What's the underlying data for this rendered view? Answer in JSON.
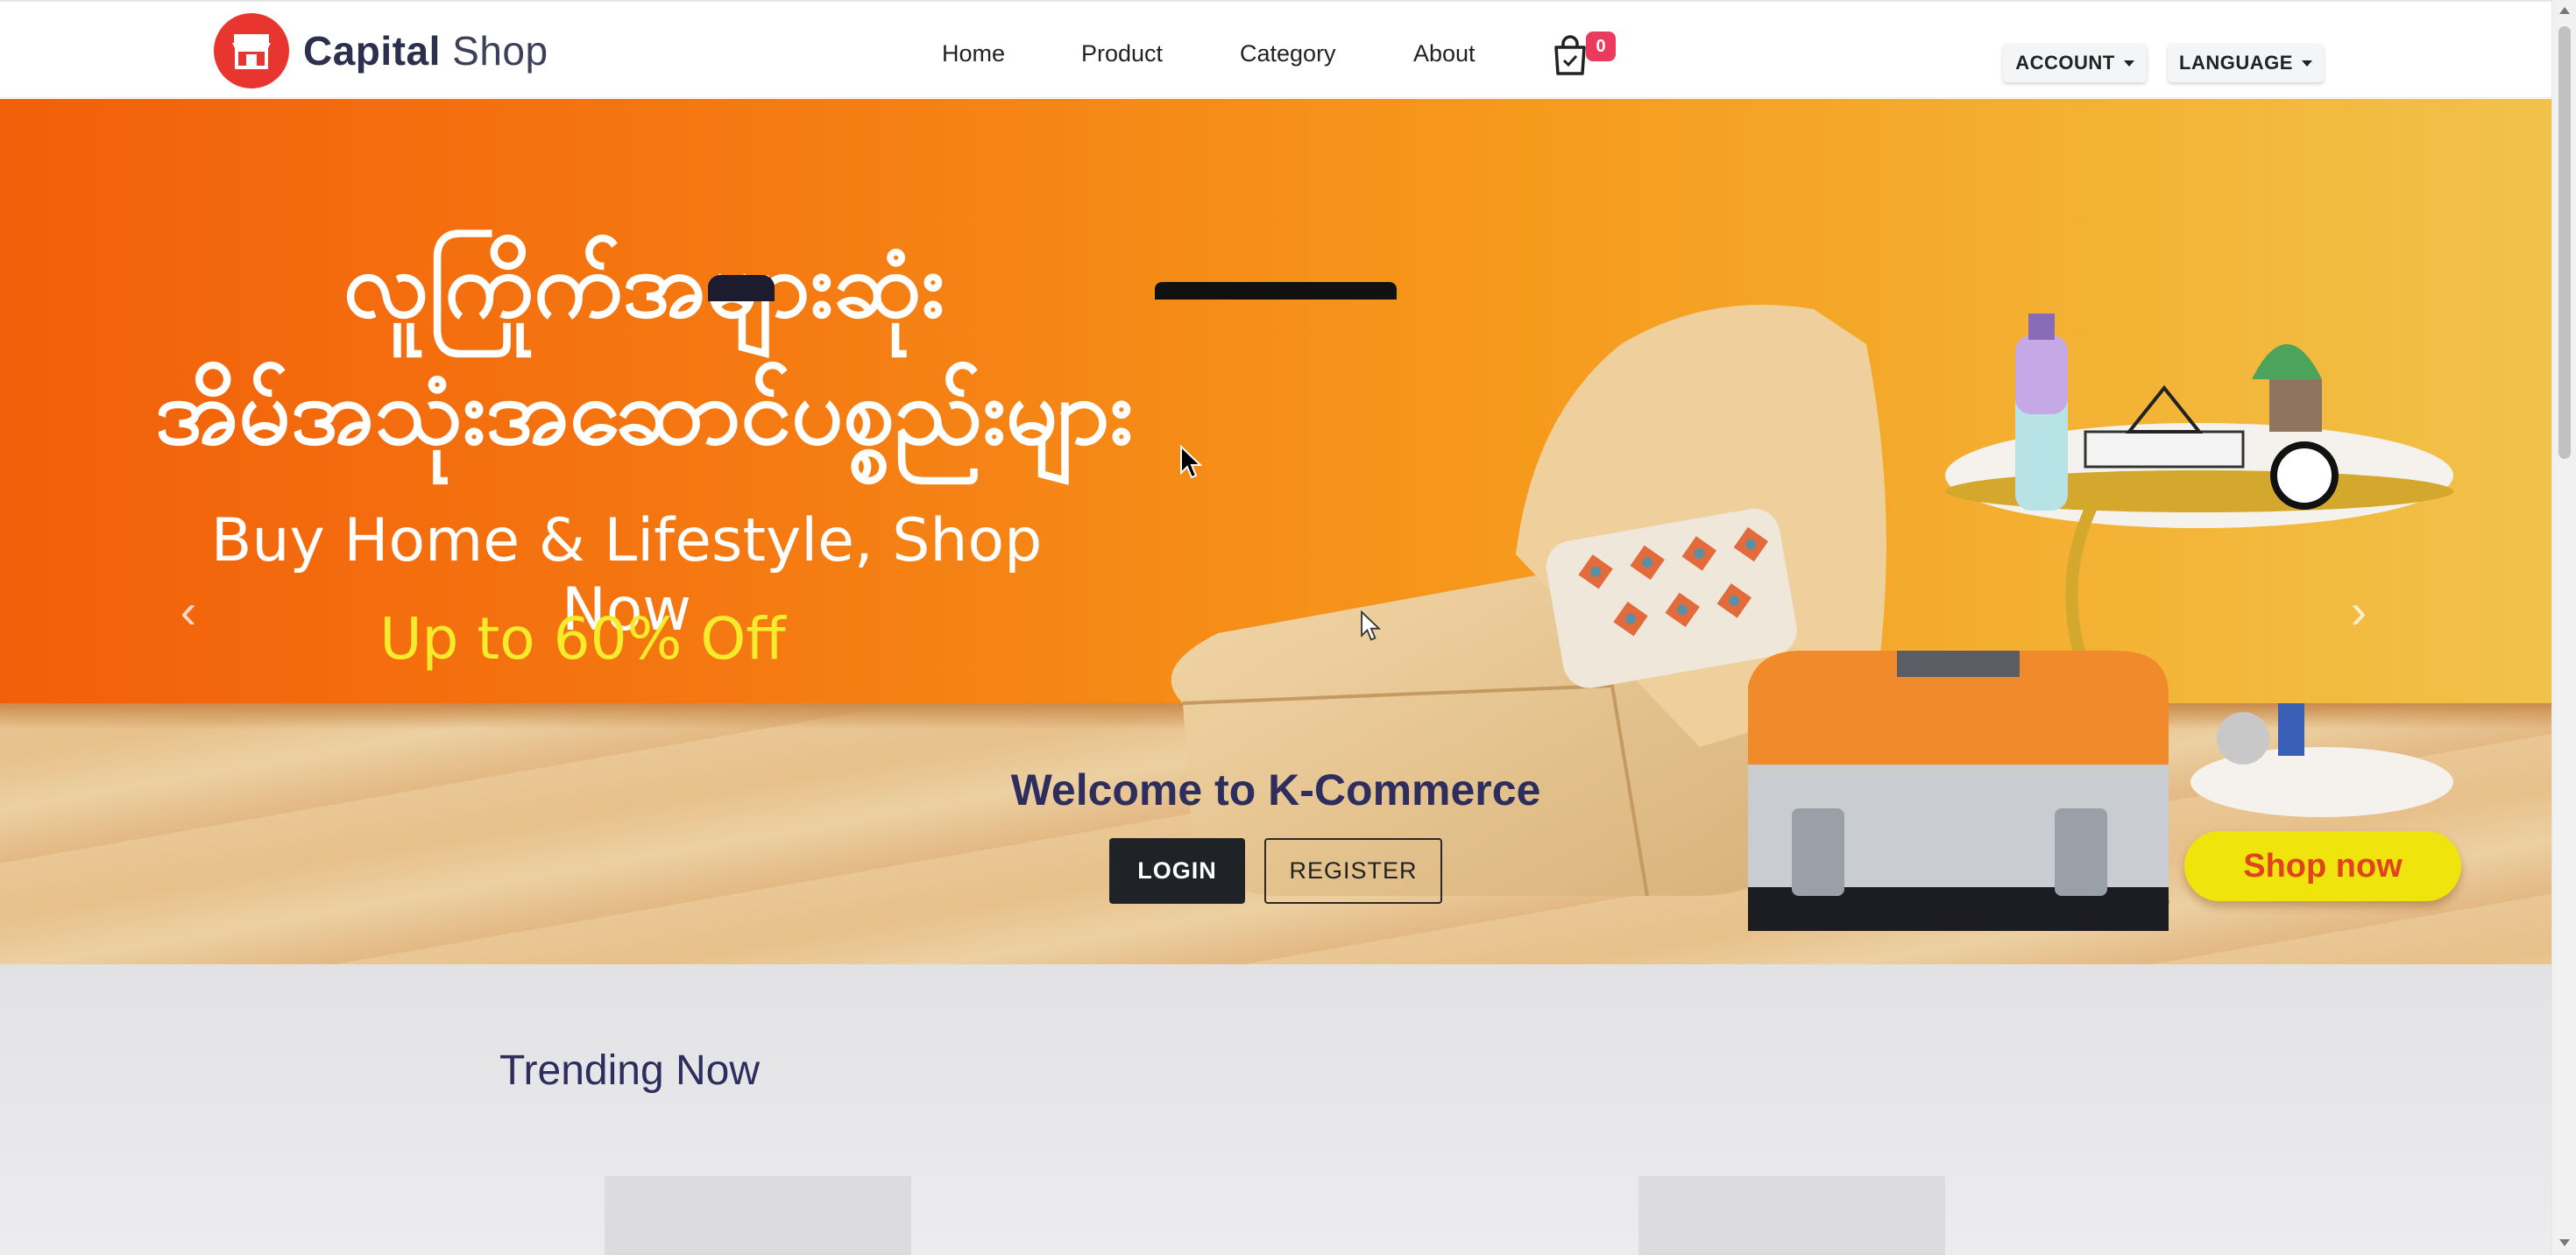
{
  "brand": {
    "name_bold": "Capital",
    "name_light": "Shop"
  },
  "nav": {
    "home": "Home",
    "product": "Product",
    "category": "Category",
    "about": "About",
    "cart_count": "0",
    "account": "ACCOUNT",
    "language": "LANGUAGE"
  },
  "hero": {
    "myanmar_line1": "လူကြိုက်အများဆုံး",
    "myanmar_line2": "အိမ်အသုံးအဆောင်ပစ္စည်းများ",
    "subtitle": "Buy Home & Lifestyle, Shop Now",
    "discount": "Up to 60% Off",
    "shop_now": "Shop now",
    "welcome": "Welcome to K-Commerce",
    "login": "LOGIN",
    "register": "REGISTER",
    "prev_arrow": "‹",
    "next_arrow": "›"
  },
  "trending": {
    "title": "Trending Now"
  },
  "colors": {
    "brand_red": "#e8352f",
    "badge": "#ec3a5d",
    "hero_orange": "#f25f0a",
    "heading_navy": "#2d2d5e",
    "shop_now_yellow": "#efe40c"
  }
}
